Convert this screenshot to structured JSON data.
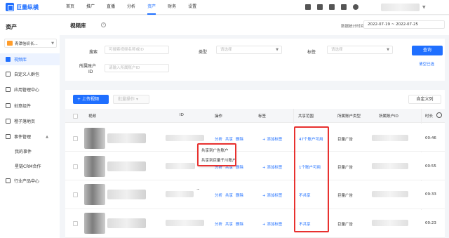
{
  "header": {
    "logo_text": "巨量纵横",
    "nav": [
      "首页",
      "推广",
      "直播",
      "分析",
      "资产",
      "财务",
      "设置"
    ],
    "active_nav": "资产"
  },
  "sidebar": {
    "title": "资产",
    "account_select": "青潭信织长...",
    "items": [
      {
        "label": "视频库",
        "active": true
      },
      {
        "label": "自定义人群包"
      },
      {
        "label": "应用管理中心"
      },
      {
        "label": "创意组件"
      },
      {
        "label": "橙子落地页"
      },
      {
        "label": "事件管理"
      },
      {
        "label": "我的事件"
      },
      {
        "label": "星链CRM合作"
      },
      {
        "label": "行业产品中心"
      }
    ]
  },
  "page": {
    "title": "视频库",
    "help_icon": "?",
    "stat_label": "数据统计时间",
    "date_range": "2022-07-19 ~ 2022-07-25"
  },
  "filters": {
    "search_label": "搜索",
    "search_placeholder": "可搜索视频名称或ID",
    "type_label": "类型",
    "type_placeholder": "请选择",
    "tag_label": "标签",
    "tag_placeholder": "请选择",
    "account_label_1": "所属账户",
    "account_label_2": "ID",
    "account_placeholder": "请输入所属账户ID",
    "query_button": "查询",
    "clear_link": "清空已选"
  },
  "toolbar": {
    "upload_button": "上传视频",
    "batch_button": "批量操作",
    "custom_columns_button": "自定义列"
  },
  "table": {
    "headers": [
      "视频",
      "ID",
      "操作",
      "标签",
      "共享范围",
      "所属账户类型",
      "所属账户ID",
      "时长"
    ],
    "op_labels": [
      "分析",
      "共享",
      "删除"
    ],
    "tag_add": "+ 添加标签",
    "rows": [
      {
        "share": "47个账户可用",
        "type": "巨量广告",
        "duration": "00:46"
      },
      {
        "share": "1个账户可用",
        "type": "巨量广告",
        "duration": "00:55"
      },
      {
        "share": "不共享",
        "type": "巨量广告",
        "duration": "09:33"
      },
      {
        "share": "不共享",
        "type": "巨量广告",
        "duration": "00:23"
      }
    ]
  },
  "share_popup": {
    "items": [
      "共享到广告账户",
      "共享到巨量千川账户"
    ]
  },
  "colors": {
    "primary": "#1f6fff",
    "highlight": "#e8312f"
  }
}
